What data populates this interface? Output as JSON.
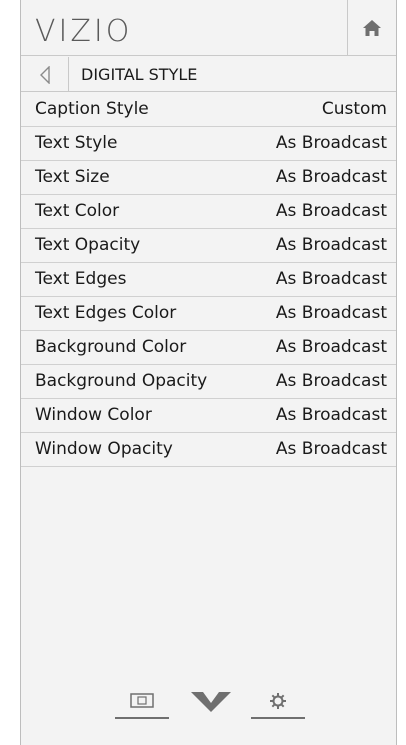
{
  "header": {
    "logo_text": "VIZIO",
    "home_icon": "home-icon"
  },
  "subheader": {
    "back_icon": "chevron-left-icon",
    "title": "DIGITAL STYLE"
  },
  "menu": {
    "items": [
      {
        "label": "Caption Style",
        "value": "Custom"
      },
      {
        "label": "Text Style",
        "value": "As Broadcast"
      },
      {
        "label": "Text Size",
        "value": "As Broadcast"
      },
      {
        "label": "Text Color",
        "value": "As Broadcast"
      },
      {
        "label": "Text Opacity",
        "value": "As Broadcast"
      },
      {
        "label": "Text Edges",
        "value": "As Broadcast"
      },
      {
        "label": "Text Edges Color",
        "value": "As Broadcast"
      },
      {
        "label": "Background Color",
        "value": "As Broadcast"
      },
      {
        "label": "Background Opacity",
        "value": "As Broadcast"
      },
      {
        "label": "Window Color",
        "value": "As Broadcast"
      },
      {
        "label": "Window Opacity",
        "value": "As Broadcast"
      }
    ]
  },
  "bottom_nav": {
    "icons": [
      "input-icon",
      "vizio-v-icon",
      "settings-gear-icon"
    ]
  },
  "colors": {
    "panel_bg": "#f3f3f3",
    "divider": "#c9c9c9",
    "text": "#1a1a1a",
    "icon": "#6f6f6f"
  }
}
